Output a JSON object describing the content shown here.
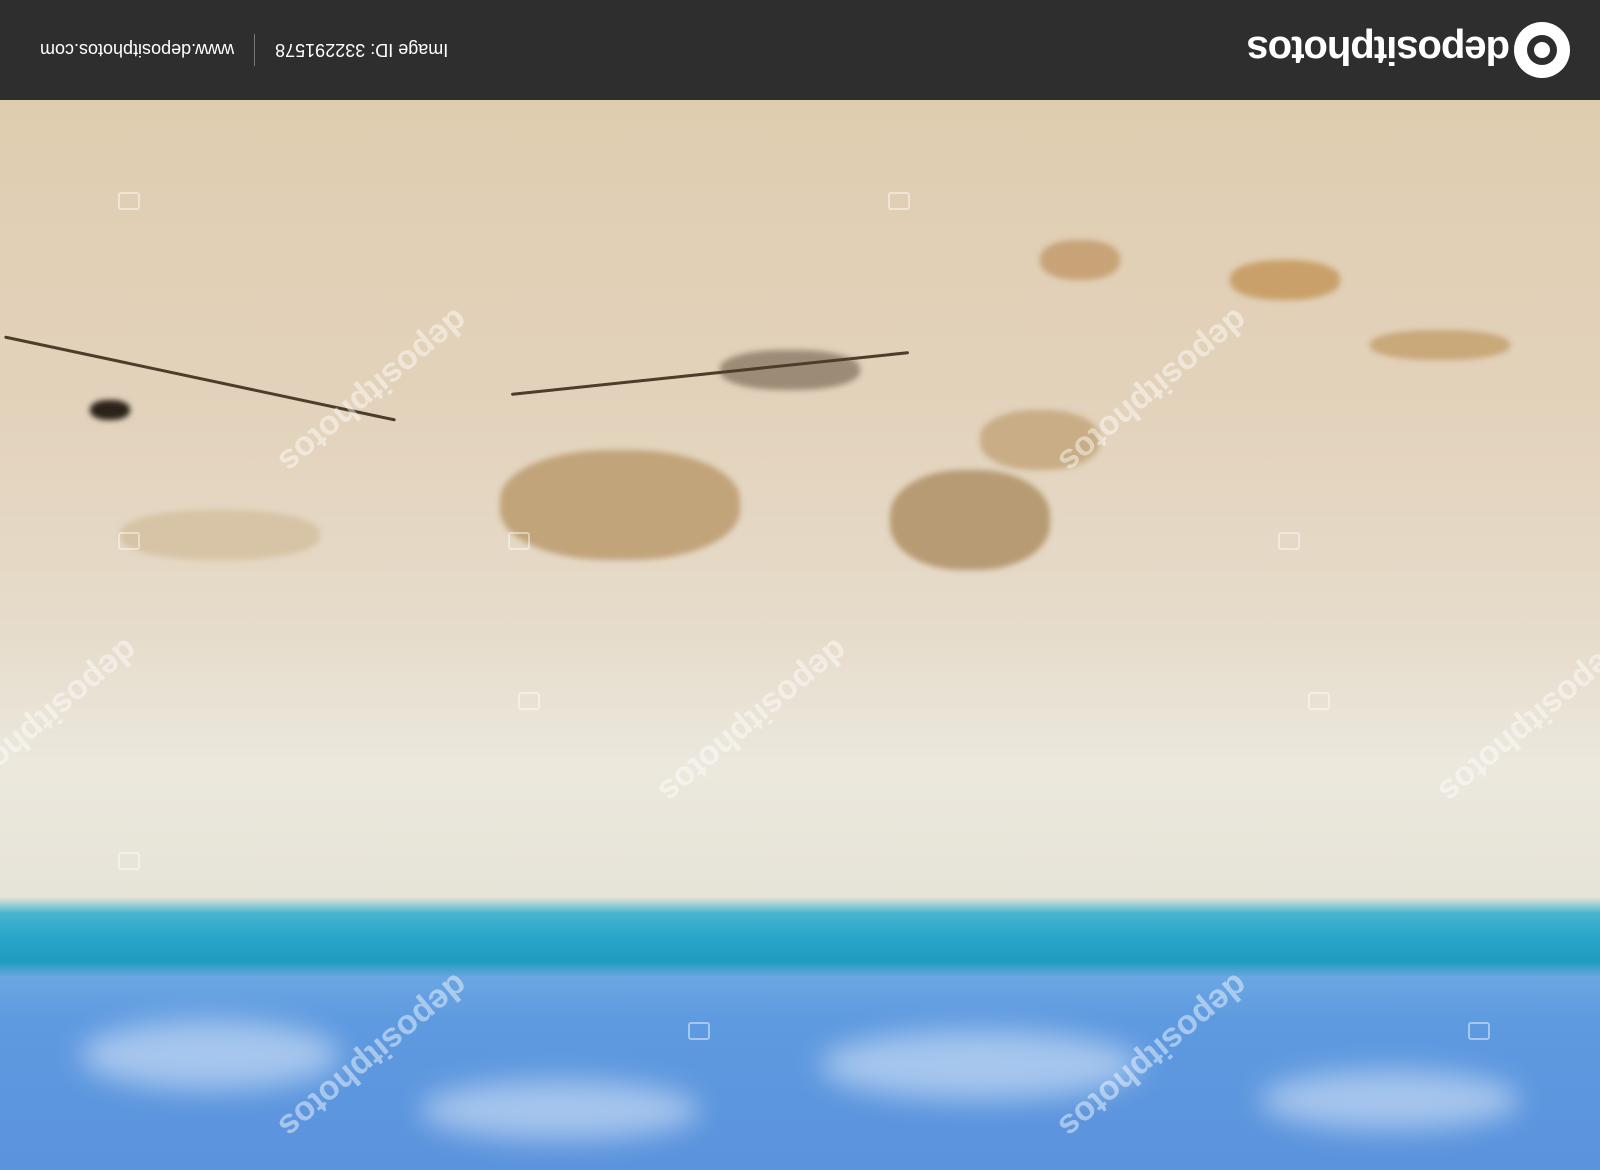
{
  "brand": {
    "logo_text": "depositphotos",
    "image_id_label": "Image ID: 332291578",
    "website": "www.depositphotos.com"
  },
  "watermark": {
    "text": "depositphotos"
  },
  "photo": {
    "description_colors": {
      "sky": "#5e9ae0",
      "sea": "#2aa7c9",
      "sand": "#e6dccb"
    }
  }
}
